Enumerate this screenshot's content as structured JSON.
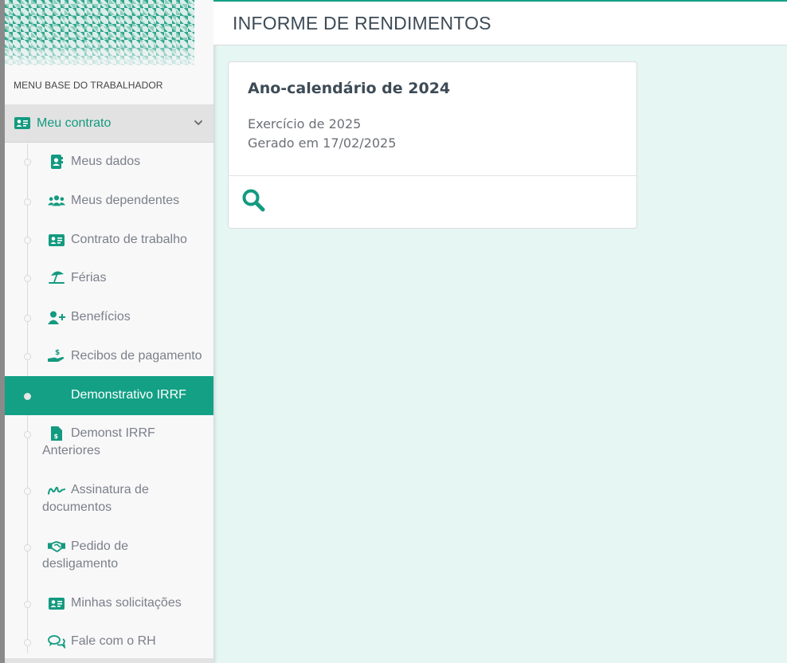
{
  "sidebar": {
    "menu_title": "MENU BASE DO TRABALHADOR",
    "group": {
      "label": "Meu contrato",
      "icon": "id-card-icon"
    },
    "items": [
      {
        "label": "Meus dados",
        "icon": "contact-book-icon"
      },
      {
        "label": "Meus dependentes",
        "icon": "users-icon"
      },
      {
        "label": "Contrato de trabalho",
        "icon": "id-card-icon"
      },
      {
        "label": "Férias",
        "icon": "beach-umbrella-icon"
      },
      {
        "label": "Benefícios",
        "icon": "user-plus-icon"
      },
      {
        "label": "Recibos de pagamento",
        "icon": "hand-dollar-icon"
      },
      {
        "label": "Demonstrativo IRRF",
        "icon": "",
        "active": true
      },
      {
        "label": "Demonst IRRF Anteriores",
        "icon": "file-dollar-icon"
      },
      {
        "label": "Assinatura de documentos",
        "icon": "signature-icon"
      },
      {
        "label": "Pedido de desligamento",
        "icon": "handshake-icon"
      },
      {
        "label": "Minhas solicitações",
        "icon": "id-card-icon"
      },
      {
        "label": "Fale com o RH",
        "icon": "chat-icon"
      }
    ]
  },
  "header": {
    "title": "INFORME DE RENDIMENTOS"
  },
  "card": {
    "title": "Ano-calendário de 2024",
    "exercise": "Exercício de 2025",
    "generated": "Gerado em 17/02/2025",
    "action_icon": "search-icon"
  },
  "colors": {
    "accent": "#13a085",
    "background": "#e5f6f3",
    "text_muted": "#7b7f8b",
    "text_dark": "#3d4b56"
  }
}
